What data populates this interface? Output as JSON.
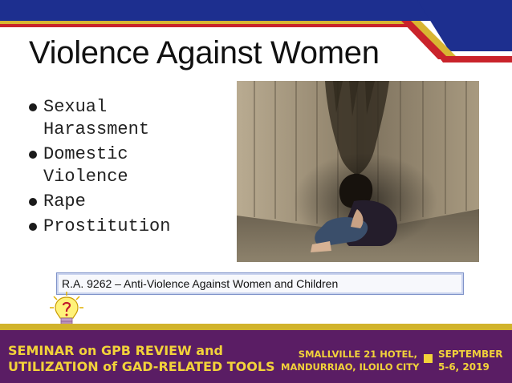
{
  "slide": {
    "title": "Violence Against Women",
    "bullets": [
      {
        "line1": "Sexual",
        "line2": "Harassment"
      },
      {
        "line1": "Domestic",
        "line2": "Violence"
      },
      {
        "line1": "Rape",
        "line2": ""
      },
      {
        "line1": "Prostitution",
        "line2": ""
      }
    ],
    "law_caption": "R.A. 9262 – Anti-Violence Against Women and Children"
  },
  "footer": {
    "seminar_line1": "SEMINAR on GPB REVIEW and",
    "seminar_line2": "UTILIZATION of GAD-RELATED TOOLS",
    "venue_line1": "SMALLVILLE 21 HOTEL,",
    "venue_line2": "MANDURRIAO, ILOILO CITY",
    "date_line1": "SEPTEMBER",
    "date_line2": "5-6, 2019"
  },
  "colors": {
    "top_blue": "#1d2f8f",
    "top_red": "#c9232b",
    "top_gold": "#d8b532",
    "footer_purple": "#5a1d64",
    "footer_text": "#f2d23a"
  },
  "icons": {
    "photo": "woman-in-corner-photo",
    "bulb": "lightbulb-question-icon"
  }
}
